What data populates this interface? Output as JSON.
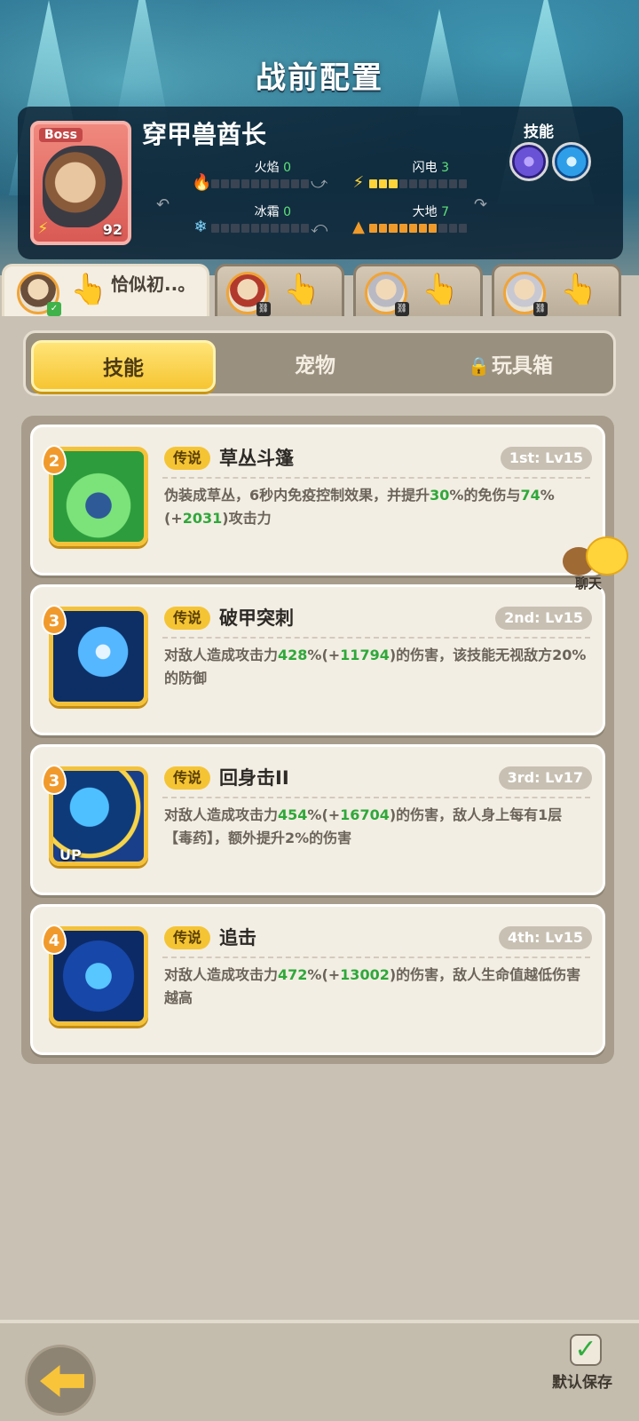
{
  "header": {
    "title": "战前配置"
  },
  "boss": {
    "tag": "Boss",
    "name": "穿甲兽酋长",
    "level": "92",
    "skills_label": "技能",
    "elements": [
      {
        "name": "火焰",
        "value": "0",
        "fill": 0,
        "icon": "flame-icon",
        "color": "#e8453a"
      },
      {
        "name": "闪电",
        "value": "3",
        "fill": 3,
        "icon": "lightning-icon",
        "color": "#ffd43a"
      },
      {
        "name": "冰霜",
        "value": "0",
        "fill": 0,
        "icon": "snowflake-icon",
        "color": "#7fd6ff"
      },
      {
        "name": "大地",
        "value": "7",
        "fill": 7,
        "icon": "mountain-icon",
        "color": "#f09a2a"
      }
    ],
    "skill_orbs": [
      {
        "icon": "swirl-skill-icon",
        "color": "#6a52d6"
      },
      {
        "icon": "ice-skill-icon",
        "color": "#2f9ee8"
      }
    ]
  },
  "heroes": [
    {
      "name": "恰似初..。",
      "active": true
    },
    {
      "name": "",
      "active": false
    },
    {
      "name": "",
      "active": false
    },
    {
      "name": "",
      "active": false
    }
  ],
  "categories": [
    {
      "label": "技能",
      "active": true
    },
    {
      "label": "宠物",
      "active": false
    },
    {
      "label": "玩具箱",
      "active": false,
      "locked": true
    }
  ],
  "skills": [
    {
      "rank": "2",
      "rarity": "传说",
      "name": "草丛斗篷",
      "level": "1st: Lv15",
      "desc_parts": [
        [
          "伪装成草丛，6秒内免疫控制效果，并提升",
          false
        ],
        [
          "30",
          true
        ],
        [
          "%的免伤与",
          false
        ],
        [
          "74",
          true
        ],
        [
          "%(+",
          false
        ],
        [
          "2031",
          true
        ],
        [
          ")攻击力",
          false
        ]
      ],
      "icon_class": "green",
      "upgrade": ""
    },
    {
      "rank": "3",
      "rarity": "传说",
      "name": "破甲突刺",
      "level": "2nd: Lv15",
      "desc_parts": [
        [
          "对敌人造成攻击力",
          false
        ],
        [
          "428",
          true
        ],
        [
          "%(+",
          false
        ],
        [
          "11794",
          true
        ],
        [
          ")的伤害，该技能无视敌方20%的防御",
          false
        ]
      ],
      "icon_class": "blue1",
      "upgrade": ""
    },
    {
      "rank": "3",
      "rarity": "传说",
      "name": "回身击II",
      "level": "3rd: Lv17",
      "desc_parts": [
        [
          "对敌人造成攻击力",
          false
        ],
        [
          "454",
          true
        ],
        [
          "%(+",
          false
        ],
        [
          "16704",
          true
        ],
        [
          ")的伤害，敌人身上每有1层【毒药】，额外提升2%的伤害",
          false
        ]
      ],
      "icon_class": "blue2",
      "upgrade": "UP"
    },
    {
      "rank": "4",
      "rarity": "传说",
      "name": "追击",
      "level": "4th: Lv15",
      "desc_parts": [
        [
          "对敌人造成攻击力",
          false
        ],
        [
          "472",
          true
        ],
        [
          "%(+",
          false
        ],
        [
          "13002",
          true
        ],
        [
          ")的伤害，敌人生命值越低伤害越高",
          false
        ]
      ],
      "icon_class": "blue3",
      "upgrade": ""
    }
  ],
  "chat": {
    "label": "聊天"
  },
  "footer": {
    "save_label": "默认保存"
  }
}
